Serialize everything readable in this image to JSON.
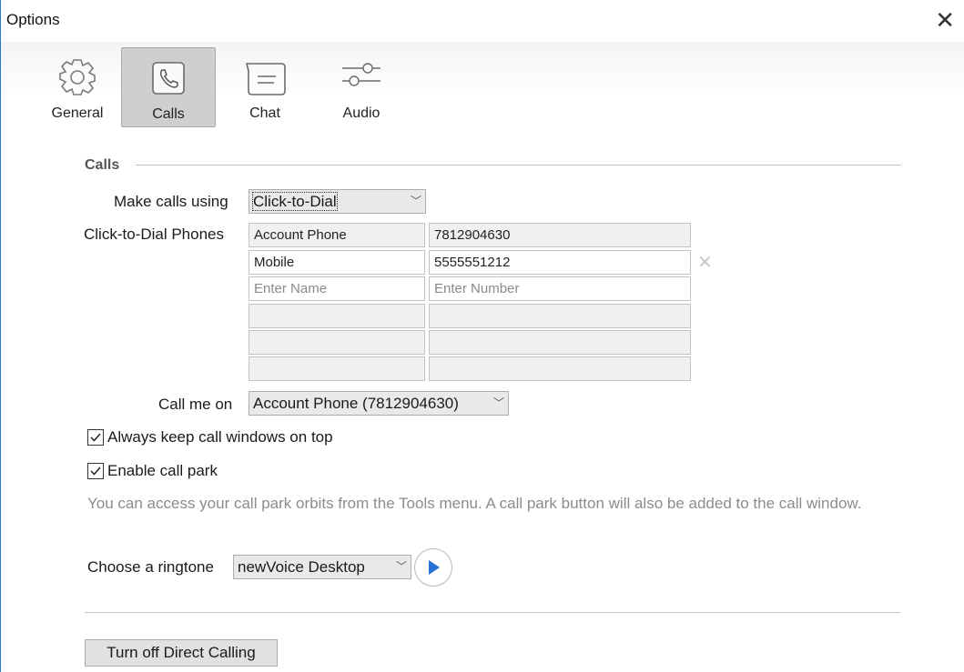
{
  "window": {
    "title": "Options",
    "close_glyph": "✕"
  },
  "toolbar": {
    "items": [
      {
        "label": "General",
        "icon": "gear-icon",
        "active": false
      },
      {
        "label": "Calls",
        "icon": "phone-icon",
        "active": true
      },
      {
        "label": "Chat",
        "icon": "chat-bubble-icon",
        "active": false
      },
      {
        "label": "Audio",
        "icon": "sliders-icon",
        "active": false
      }
    ]
  },
  "calls": {
    "section_title": "Calls",
    "make_calls_label": "Make calls using",
    "make_calls_value": "Click-to-Dial",
    "phones_label": "Click-to-Dial Phones",
    "phones": [
      {
        "name": "Account Phone",
        "number": "7812904630"
      },
      {
        "name": "Mobile",
        "number": "5555551212"
      }
    ],
    "new_name_placeholder": "Enter Name",
    "new_number_placeholder": "Enter Number",
    "delete_glyph": "✕",
    "call_me_on_label": "Call me on",
    "call_me_on_value": "Account Phone (7812904630)",
    "keep_on_top_label": "Always keep call windows on top",
    "keep_on_top_checked": true,
    "call_park_label": "Enable call park",
    "call_park_checked": true,
    "call_park_hint": "You can access your call park orbits from the Tools menu. A call park button will also be added to the call window.",
    "ringtone_label": "Choose a ringtone",
    "ringtone_value": "newVoice Desktop",
    "turn_off_button": "Turn off Direct Calling"
  },
  "colors": {
    "accent": "#2b79c8",
    "play": "#2a6fd6"
  }
}
